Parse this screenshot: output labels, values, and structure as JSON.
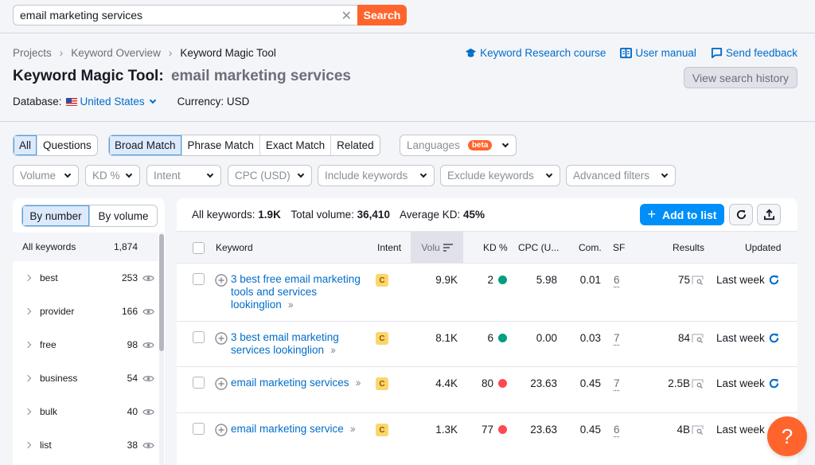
{
  "search": {
    "value": "email marketing services",
    "button_label": "Search",
    "clear_icon": "close-icon"
  },
  "breadcrumb": [
    "Projects",
    "Keyword Overview",
    "Keyword Magic Tool"
  ],
  "header": {
    "title": "Keyword Magic Tool:",
    "query": "email marketing services",
    "database_label": "Database:",
    "database_value": "United States",
    "currency": "Currency: USD",
    "links": [
      {
        "label": "Keyword Research course",
        "icon": "graduation-cap-icon"
      },
      {
        "label": "User manual",
        "icon": "book-icon"
      },
      {
        "label": "Send feedback",
        "icon": "feedback-icon"
      }
    ],
    "history_button": "View search history"
  },
  "filters": {
    "scope_tabs": [
      {
        "label": "All",
        "active": true
      },
      {
        "label": "Questions",
        "active": false
      }
    ],
    "match_tabs": [
      {
        "label": "Broad Match",
        "active": true
      },
      {
        "label": "Phrase Match",
        "active": false
      },
      {
        "label": "Exact Match",
        "active": false
      },
      {
        "label": "Related",
        "active": false
      }
    ],
    "languages": {
      "label": "Languages",
      "badge": "beta"
    },
    "dropdowns": [
      "Volume",
      "KD %",
      "Intent",
      "CPC (USD)",
      "Include keywords",
      "Exclude keywords",
      "Advanced filters"
    ]
  },
  "groups": {
    "toggle": [
      {
        "label": "By number",
        "active": true
      },
      {
        "label": "By volume",
        "active": false
      }
    ],
    "all": {
      "label": "All keywords",
      "count": "1,874"
    },
    "items": [
      {
        "label": "best",
        "count": "253"
      },
      {
        "label": "provider",
        "count": "166"
      },
      {
        "label": "free",
        "count": "98"
      },
      {
        "label": "business",
        "count": "54"
      },
      {
        "label": "bulk",
        "count": "40"
      },
      {
        "label": "list",
        "count": "38"
      }
    ]
  },
  "summary": {
    "all_label": "All keywords:",
    "all_value": "1.9K",
    "vol_label": "Total volume:",
    "vol_value": "36,410",
    "kd_label": "Average KD:",
    "kd_value": "45%"
  },
  "toolbar": {
    "add_to_list": "Add to list"
  },
  "table": {
    "columns": [
      "Keyword",
      "Intent",
      "Volu",
      "KD %",
      "CPC (U...",
      "Com.",
      "SF",
      "Results",
      "Updated"
    ],
    "rows": [
      {
        "keyword": "3 best free email marketing tools and services lookinglion",
        "intent": "C",
        "volume": "9.9K",
        "kd": "2",
        "kd_color": "#009f81",
        "cpc": "5.98",
        "com": "0.01",
        "sf": "6",
        "results": "75",
        "updated": "Last week"
      },
      {
        "keyword": "3 best email marketing services lookinglion",
        "intent": "C",
        "volume": "8.1K",
        "kd": "6",
        "kd_color": "#009f81",
        "cpc": "0.00",
        "com": "0.03",
        "sf": "7",
        "results": "84",
        "updated": "Last week"
      },
      {
        "keyword": "email marketing services",
        "intent": "C",
        "volume": "4.4K",
        "kd": "80",
        "kd_color": "#ff4953",
        "cpc": "23.63",
        "com": "0.45",
        "sf": "7",
        "results": "2.5B",
        "updated": "Last week"
      },
      {
        "keyword": "email marketing service",
        "intent": "C",
        "volume": "1.3K",
        "kd": "77",
        "kd_color": "#ff4953",
        "cpc": "23.63",
        "com": "0.45",
        "sf": "6",
        "results": "4B",
        "updated": "Last week"
      }
    ]
  },
  "help_button": "?",
  "colors": {
    "accent_orange": "#ff642d",
    "accent_blue": "#008ff8",
    "link_blue": "#006dca"
  }
}
